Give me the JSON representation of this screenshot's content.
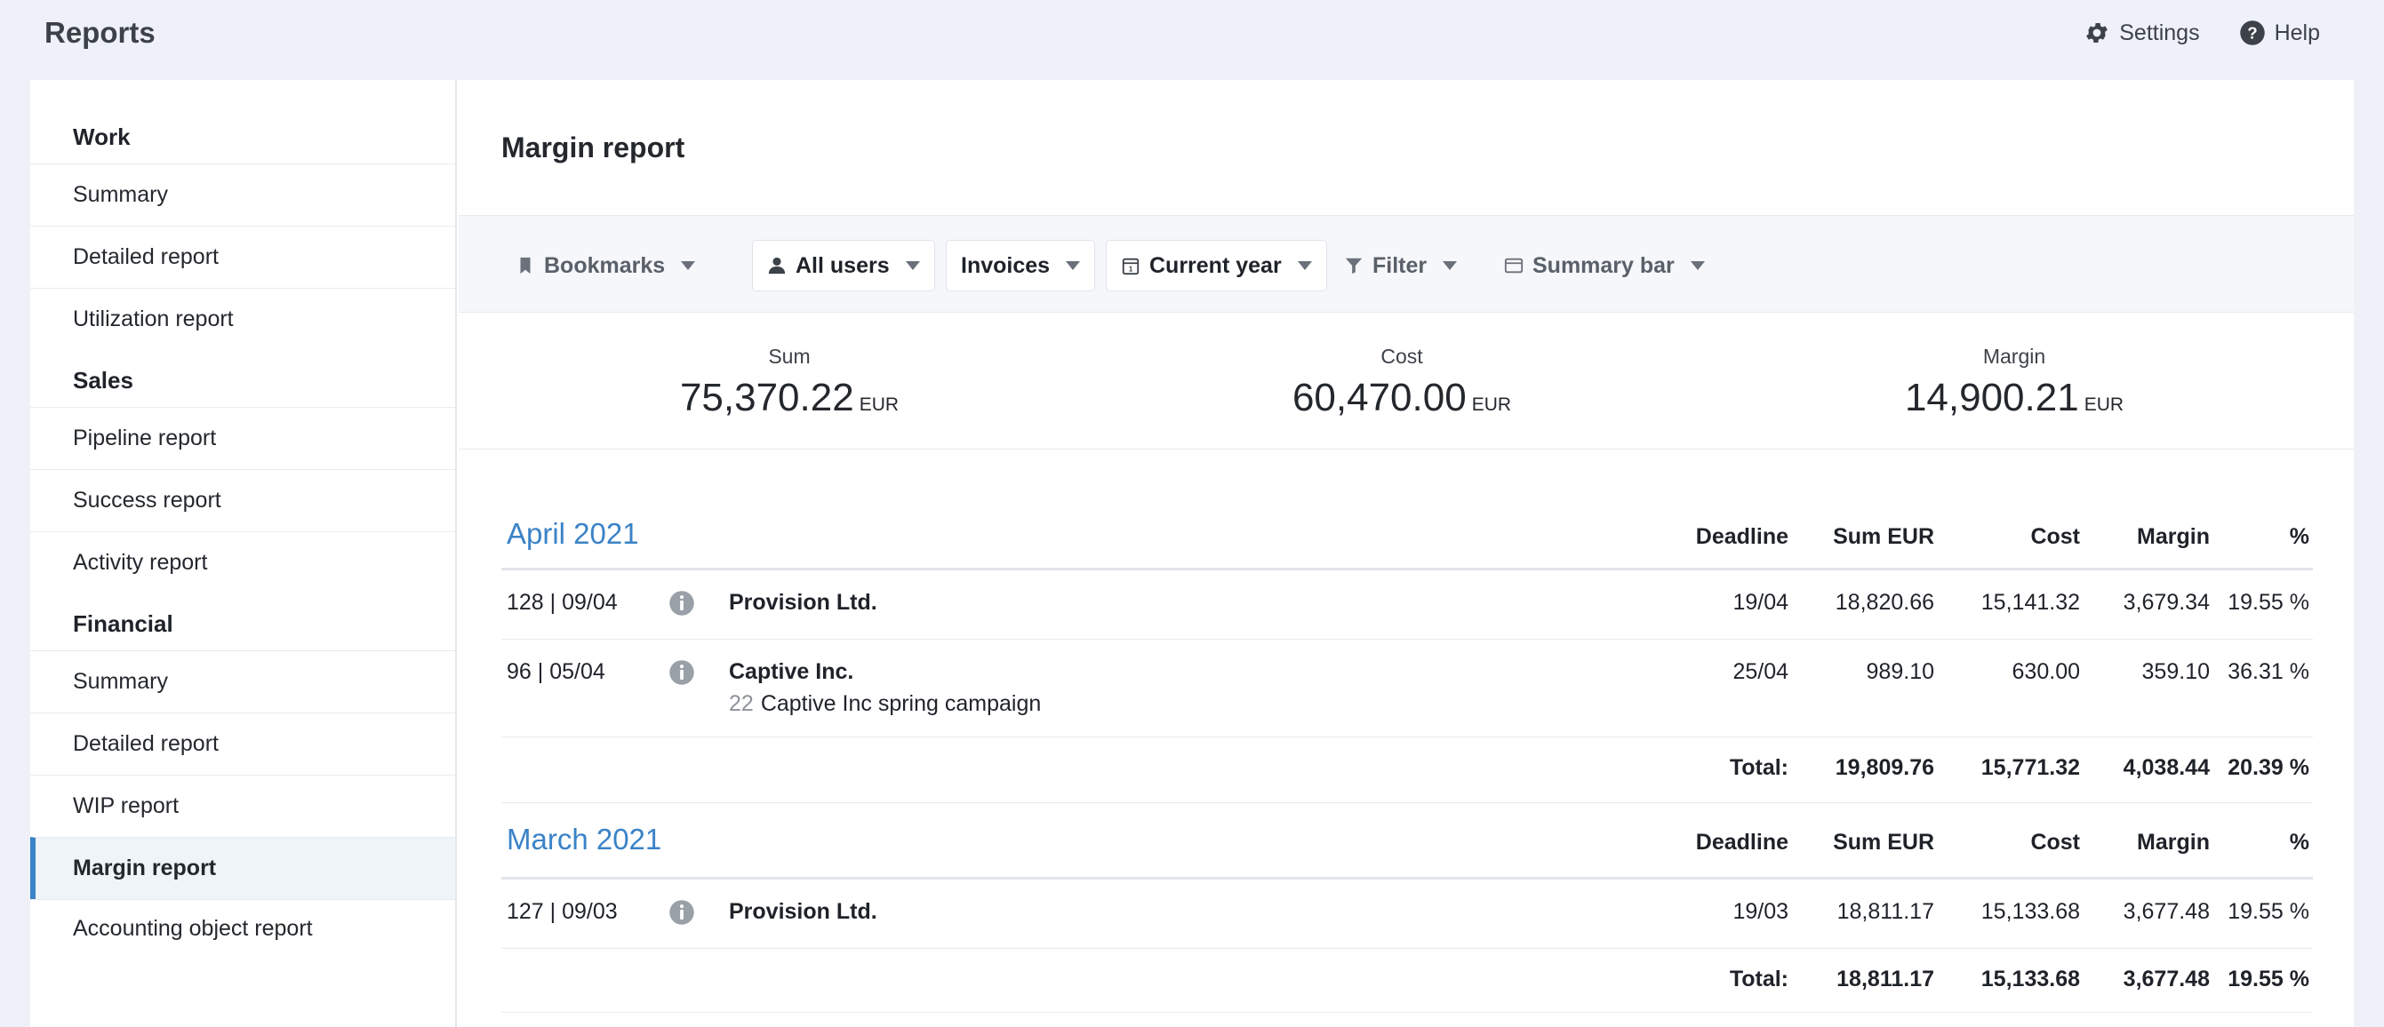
{
  "app": {
    "title": "Reports",
    "settings": "Settings",
    "help": "Help"
  },
  "sidebar": {
    "groups": [
      {
        "title": "Work",
        "items": [
          "Summary",
          "Detailed report",
          "Utilization report"
        ]
      },
      {
        "title": "Sales",
        "items": [
          "Pipeline report",
          "Success report",
          "Activity report"
        ]
      },
      {
        "title": "Financial",
        "items": [
          "Summary",
          "Detailed report",
          "WIP report",
          "Margin report",
          "Accounting object report"
        ]
      }
    ],
    "active": "Margin report"
  },
  "page": {
    "title": "Margin report"
  },
  "toolbar": {
    "bookmarks": "Bookmarks",
    "users": "All users",
    "type": "Invoices",
    "period": "Current year",
    "filter": "Filter",
    "summary_bar": "Summary bar"
  },
  "summary": {
    "sum_label": "Sum",
    "sum": "75,370.22",
    "cost_label": "Cost",
    "cost": "60,470.00",
    "margin_label": "Margin",
    "margin": "14,900.21",
    "currency": "EUR"
  },
  "columns": {
    "deadline": "Deadline",
    "sum": "Sum EUR",
    "cost": "Cost",
    "margin": "Margin",
    "pct": "%"
  },
  "months": [
    {
      "title": "April 2021",
      "rows": [
        {
          "invoice": "128 | 09/04",
          "client": "Provision Ltd.",
          "project_no": "",
          "project": "",
          "deadline": "19/04",
          "sum": "18,820.66",
          "cost": "15,141.32",
          "margin": "3,679.34",
          "pct": "19.55 %"
        },
        {
          "invoice": "96 | 05/04",
          "client": "Captive Inc.",
          "project_no": "22",
          "project": "Captive Inc spring campaign",
          "deadline": "25/04",
          "sum": "989.10",
          "cost": "630.00",
          "margin": "359.10",
          "pct": "36.31 %"
        }
      ],
      "total": {
        "label": "Total:",
        "sum": "19,809.76",
        "cost": "15,771.32",
        "margin": "4,038.44",
        "pct": "20.39 %"
      }
    },
    {
      "title": "March 2021",
      "rows": [
        {
          "invoice": "127 | 09/03",
          "client": "Provision Ltd.",
          "project_no": "",
          "project": "",
          "deadline": "19/03",
          "sum": "18,811.17",
          "cost": "15,133.68",
          "margin": "3,677.48",
          "pct": "19.55 %"
        }
      ],
      "total": {
        "label": "Total:",
        "sum": "18,811.17",
        "cost": "15,133.68",
        "margin": "3,677.48",
        "pct": "19.55 %"
      }
    }
  ]
}
